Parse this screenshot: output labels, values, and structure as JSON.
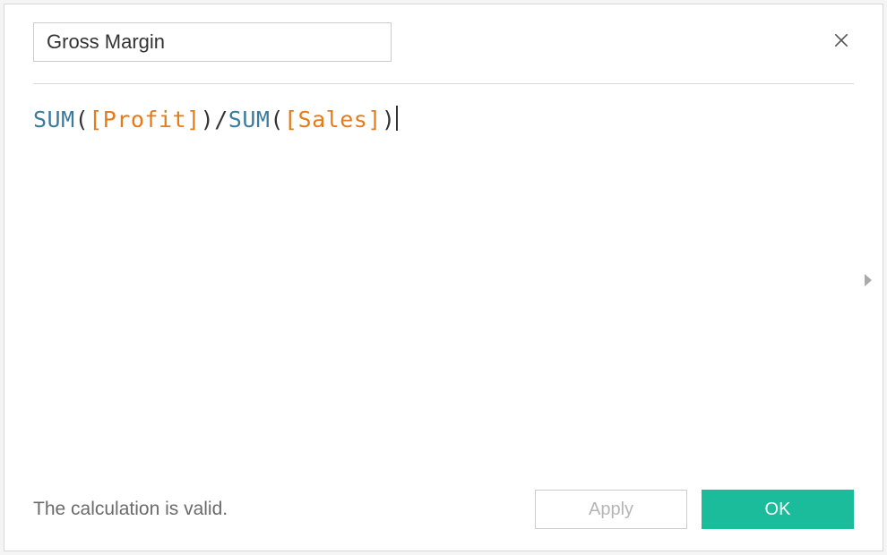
{
  "calculationName": "Gross Margin",
  "statusText": "The calculation is valid.",
  "buttons": {
    "applyLabel": "Apply",
    "okLabel": "OK"
  },
  "formula": {
    "raw": "SUM([Profit])/SUM([Sales])",
    "tokens": [
      {
        "type": "func",
        "text": "SUM"
      },
      {
        "type": "punct",
        "text": "("
      },
      {
        "type": "field",
        "text": "[Profit]"
      },
      {
        "type": "punct",
        "text": ")"
      },
      {
        "type": "punct",
        "text": "/"
      },
      {
        "type": "func",
        "text": "SUM"
      },
      {
        "type": "punct",
        "text": "("
      },
      {
        "type": "field",
        "text": "[Sales]"
      },
      {
        "type": "punct",
        "text": ")"
      }
    ]
  },
  "colors": {
    "accentOk": "#1abc9c",
    "function": "#3b7b9e",
    "field": "#e67b1a"
  }
}
